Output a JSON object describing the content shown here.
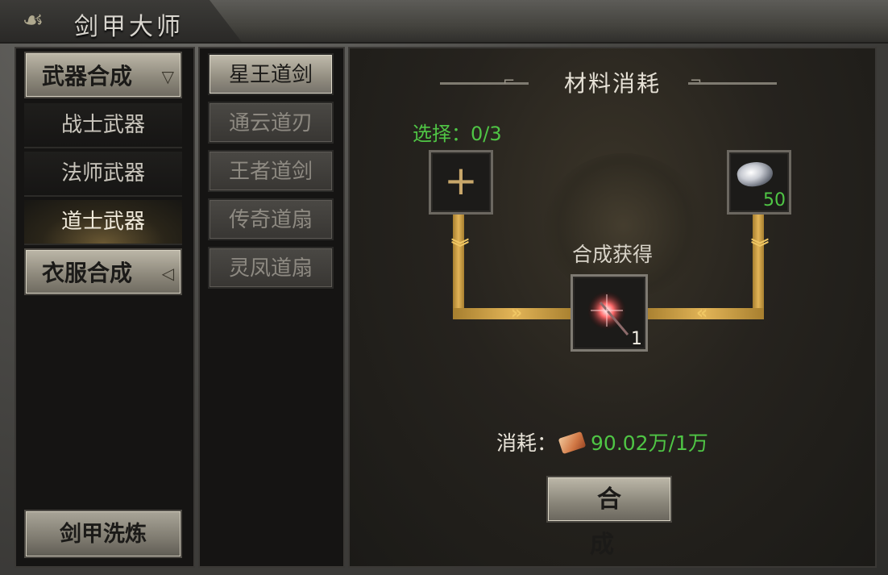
{
  "window": {
    "title": "剑甲大师"
  },
  "left_menu": {
    "weapon_category": "武器合成",
    "sub_items": [
      "战士武器",
      "法师武器",
      "道士武器"
    ],
    "active_sub_index": 2,
    "armor_category": "衣服合成",
    "bottom_button": "剑甲洗炼"
  },
  "weapon_list": {
    "items": [
      "星王道剑",
      "通云道刃",
      "王者道剑",
      "传奇道扇",
      "灵凤道扇"
    ],
    "active_index": 0
  },
  "craft_panel": {
    "title": "材料消耗",
    "choose_label": "选择：0/3",
    "material_count": "50",
    "result_label": "合成获得",
    "result_count": "1",
    "cost_label": "消耗：",
    "cost_value": "90.02万/1万",
    "craft_button": "合　成"
  },
  "colors": {
    "highlight_green": "#4fc545",
    "gold_connector": "#e2b457"
  }
}
